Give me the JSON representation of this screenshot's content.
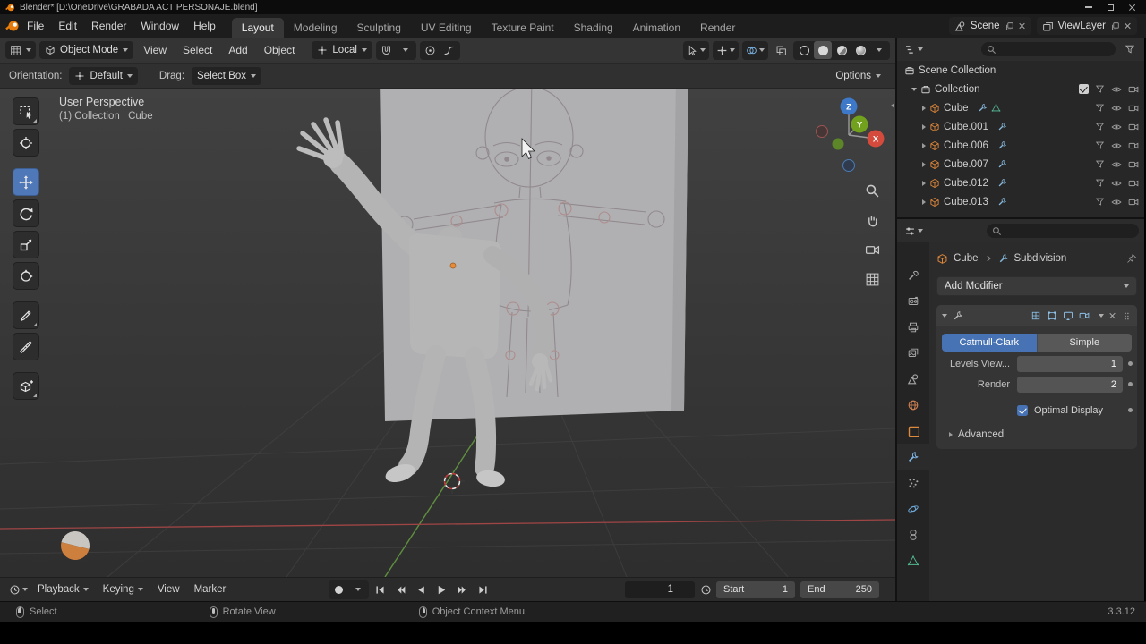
{
  "titlebar": {
    "title": "Blender* [D:\\OneDrive\\GRABADA ACT PERSONAJE.blend]"
  },
  "topbar": {
    "menus": [
      "File",
      "Edit",
      "Render",
      "Window",
      "Help"
    ],
    "tabs": [
      "Layout",
      "Modeling",
      "Sculpting",
      "UV Editing",
      "Texture Paint",
      "Shading",
      "Animation",
      "Render"
    ],
    "scene_name": "Scene",
    "viewlayer_name": "ViewLayer"
  },
  "tool_header": {
    "mode": "Object Mode",
    "menus": [
      "View",
      "Select",
      "Add",
      "Object"
    ],
    "orientation": "Local"
  },
  "tool_settings": {
    "orientation_label": "Orientation:",
    "orientation_value": "Default",
    "drag_label": "Drag:",
    "drag_value": "Select Box",
    "options_label": "Options"
  },
  "viewport": {
    "overlay_title": "User Perspective",
    "overlay_subtitle": "(1) Collection | Cube",
    "gizmo_axes": {
      "x": "X",
      "y": "Y",
      "z": "Z"
    }
  },
  "outliner": {
    "rows": [
      {
        "label": "Scene Collection"
      },
      {
        "label": "Collection"
      },
      {
        "label": "Cube"
      },
      {
        "label": "Cube.001"
      },
      {
        "label": "Cube.006"
      },
      {
        "label": "Cube.007"
      },
      {
        "label": "Cube.012"
      },
      {
        "label": "Cube.013"
      }
    ]
  },
  "properties": {
    "breadcrumb": {
      "object": "Cube",
      "modifier": "Subdivision"
    },
    "add_modifier_label": "Add Modifier",
    "modifier_panel": {
      "type_catmull": "Catmull-Clark",
      "type_simple": "Simple",
      "levels_label": "Levels View...",
      "levels_value": "1",
      "render_label": "Render",
      "render_value": "2",
      "optimal_display_label": "Optimal Display",
      "advanced_label": "Advanced"
    }
  },
  "timeline": {
    "menus": [
      "Playback",
      "Keying",
      "View",
      "Marker"
    ],
    "current_frame": "1",
    "start_label": "Start",
    "start_value": "1",
    "end_label": "End",
    "end_value": "250"
  },
  "statusbar": {
    "left_click": "Select",
    "middle_click": "Rotate View",
    "right_click": "Object Context Menu",
    "version": "3.3.12"
  },
  "colors": {
    "accent_blue": "#4772b3",
    "object_orange": "#e0883a"
  }
}
